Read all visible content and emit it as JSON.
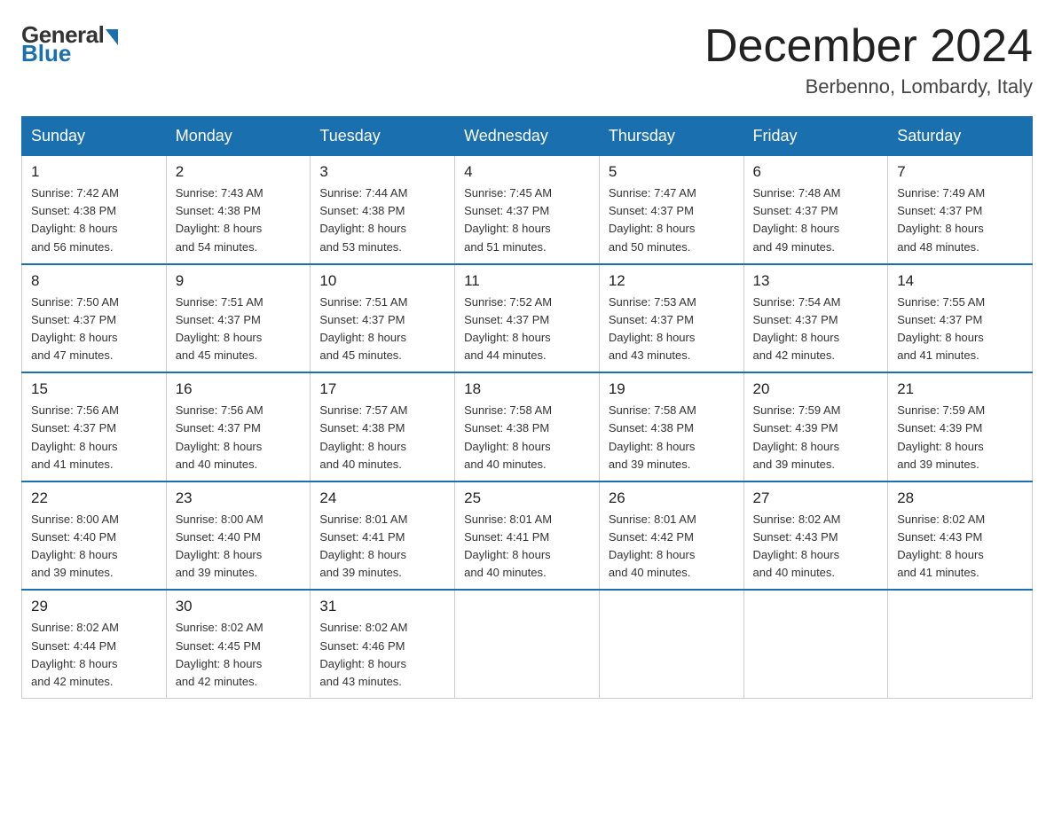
{
  "logo": {
    "general": "General",
    "blue": "Blue"
  },
  "header": {
    "month_year": "December 2024",
    "location": "Berbenno, Lombardy, Italy"
  },
  "days_of_week": [
    "Sunday",
    "Monday",
    "Tuesday",
    "Wednesday",
    "Thursday",
    "Friday",
    "Saturday"
  ],
  "weeks": [
    [
      {
        "day": "1",
        "sunrise": "7:42 AM",
        "sunset": "4:38 PM",
        "daylight": "8 hours and 56 minutes."
      },
      {
        "day": "2",
        "sunrise": "7:43 AM",
        "sunset": "4:38 PM",
        "daylight": "8 hours and 54 minutes."
      },
      {
        "day": "3",
        "sunrise": "7:44 AM",
        "sunset": "4:38 PM",
        "daylight": "8 hours and 53 minutes."
      },
      {
        "day": "4",
        "sunrise": "7:45 AM",
        "sunset": "4:37 PM",
        "daylight": "8 hours and 51 minutes."
      },
      {
        "day": "5",
        "sunrise": "7:47 AM",
        "sunset": "4:37 PM",
        "daylight": "8 hours and 50 minutes."
      },
      {
        "day": "6",
        "sunrise": "7:48 AM",
        "sunset": "4:37 PM",
        "daylight": "8 hours and 49 minutes."
      },
      {
        "day": "7",
        "sunrise": "7:49 AM",
        "sunset": "4:37 PM",
        "daylight": "8 hours and 48 minutes."
      }
    ],
    [
      {
        "day": "8",
        "sunrise": "7:50 AM",
        "sunset": "4:37 PM",
        "daylight": "8 hours and 47 minutes."
      },
      {
        "day": "9",
        "sunrise": "7:51 AM",
        "sunset": "4:37 PM",
        "daylight": "8 hours and 45 minutes."
      },
      {
        "day": "10",
        "sunrise": "7:51 AM",
        "sunset": "4:37 PM",
        "daylight": "8 hours and 45 minutes."
      },
      {
        "day": "11",
        "sunrise": "7:52 AM",
        "sunset": "4:37 PM",
        "daylight": "8 hours and 44 minutes."
      },
      {
        "day": "12",
        "sunrise": "7:53 AM",
        "sunset": "4:37 PM",
        "daylight": "8 hours and 43 minutes."
      },
      {
        "day": "13",
        "sunrise": "7:54 AM",
        "sunset": "4:37 PM",
        "daylight": "8 hours and 42 minutes."
      },
      {
        "day": "14",
        "sunrise": "7:55 AM",
        "sunset": "4:37 PM",
        "daylight": "8 hours and 41 minutes."
      }
    ],
    [
      {
        "day": "15",
        "sunrise": "7:56 AM",
        "sunset": "4:37 PM",
        "daylight": "8 hours and 41 minutes."
      },
      {
        "day": "16",
        "sunrise": "7:56 AM",
        "sunset": "4:37 PM",
        "daylight": "8 hours and 40 minutes."
      },
      {
        "day": "17",
        "sunrise": "7:57 AM",
        "sunset": "4:38 PM",
        "daylight": "8 hours and 40 minutes."
      },
      {
        "day": "18",
        "sunrise": "7:58 AM",
        "sunset": "4:38 PM",
        "daylight": "8 hours and 40 minutes."
      },
      {
        "day": "19",
        "sunrise": "7:58 AM",
        "sunset": "4:38 PM",
        "daylight": "8 hours and 39 minutes."
      },
      {
        "day": "20",
        "sunrise": "7:59 AM",
        "sunset": "4:39 PM",
        "daylight": "8 hours and 39 minutes."
      },
      {
        "day": "21",
        "sunrise": "7:59 AM",
        "sunset": "4:39 PM",
        "daylight": "8 hours and 39 minutes."
      }
    ],
    [
      {
        "day": "22",
        "sunrise": "8:00 AM",
        "sunset": "4:40 PM",
        "daylight": "8 hours and 39 minutes."
      },
      {
        "day": "23",
        "sunrise": "8:00 AM",
        "sunset": "4:40 PM",
        "daylight": "8 hours and 39 minutes."
      },
      {
        "day": "24",
        "sunrise": "8:01 AM",
        "sunset": "4:41 PM",
        "daylight": "8 hours and 39 minutes."
      },
      {
        "day": "25",
        "sunrise": "8:01 AM",
        "sunset": "4:41 PM",
        "daylight": "8 hours and 40 minutes."
      },
      {
        "day": "26",
        "sunrise": "8:01 AM",
        "sunset": "4:42 PM",
        "daylight": "8 hours and 40 minutes."
      },
      {
        "day": "27",
        "sunrise": "8:02 AM",
        "sunset": "4:43 PM",
        "daylight": "8 hours and 40 minutes."
      },
      {
        "day": "28",
        "sunrise": "8:02 AM",
        "sunset": "4:43 PM",
        "daylight": "8 hours and 41 minutes."
      }
    ],
    [
      {
        "day": "29",
        "sunrise": "8:02 AM",
        "sunset": "4:44 PM",
        "daylight": "8 hours and 42 minutes."
      },
      {
        "day": "30",
        "sunrise": "8:02 AM",
        "sunset": "4:45 PM",
        "daylight": "8 hours and 42 minutes."
      },
      {
        "day": "31",
        "sunrise": "8:02 AM",
        "sunset": "4:46 PM",
        "daylight": "8 hours and 43 minutes."
      },
      null,
      null,
      null,
      null
    ]
  ],
  "labels": {
    "sunrise": "Sunrise:",
    "sunset": "Sunset:",
    "daylight": "Daylight:"
  }
}
